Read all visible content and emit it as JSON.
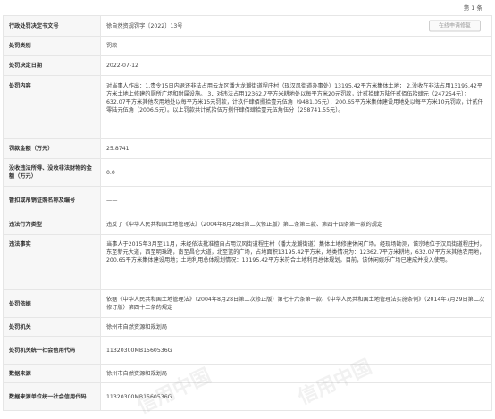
{
  "page": {
    "number_label": "第 1 条"
  },
  "online_button": "在线申请修复",
  "watermark": "信用中国",
  "rows": [
    {
      "label": "行政处罚决定书文号",
      "value": "徐自然资规罚字〔2022〕13号"
    },
    {
      "label": "处罚类别",
      "value": "罚款"
    },
    {
      "label": "处罚决定日期",
      "value": "2022-07-12"
    },
    {
      "label": "处罚内容",
      "value": "对当事人作出：1.责令15日内退还非法占用云龙区潘大龙潮街道程庄村（现汉风街道办事处）13195.42平方米集体土地； 2.没收在非法占用13195.42平方米土地上修建的厕所广场和附属设施。 3．对违法占用12362.7平方米耕地处以每平方米20元罚款，计贰拾肆万陆仟贰佰伍拾肆元（247254元）；632.07平方米其他农用地处以每平方米15元罚款，计玖仟肆佰捌拾壹元伍角（9481.05元）；200.65平方米集体建设用地处以每平方米10元罚款，计贰仟零陆元伍角（2006.5元）。以上罚款共计贰拾伍万捌仟肆佰肆拾壹元伍角伍分（258741.55元）。"
    },
    {
      "label": "罚款金额（万元）",
      "value": "25.8741"
    },
    {
      "label": "没收违法所得、没收非法财物的金额（万元）",
      "value": "0.0"
    },
    {
      "label": "暂扣或吊销证照名称及编号",
      "value": "——"
    },
    {
      "label": "违法行为类型",
      "value": "违反了《中华人民共和国土地管理法》（2004年8月28日第二次修正版）第二条第三款、第四十四条第一款的规定"
    },
    {
      "label": "违法事实",
      "value": "当事人于2015年3月至11月，未经依法批准擅自占用汉风街道程庄村（潘大龙潮街道）集体土地修建休闲广场。经现场勘测，该宗地位于汉风街道程庄村，东至新元大道，西至明珠路，南至昌仑大道，北至篮的广场，占地面积13195.42平方米，地类情况为：12362.7平方米耕地，632.07平方米其他农用地，200.65平方米集体建设用地；土地利用总体规划情况：13195.42平方米符合土地利用总体规划。目前，该休闲娱乐广场已建成并投入使用。"
    },
    {
      "label": "处罚依据",
      "value": "依据《中华人民共和国土地管理法》（2004年8月28日第二次修正版）第七十六条第一款、《中华人民共和国土地管理法实施条例》（2014年7月29日第二次修订版）第四十二条的规定"
    },
    {
      "label": "处罚机关",
      "value": "徐州市自然资源和规划局"
    },
    {
      "label": "处罚机关统一社会信用代码",
      "value": "11320300MB1560536G"
    },
    {
      "label": "数据来源",
      "value": "徐州市自然资源和规划局"
    },
    {
      "label": "数据来源单位统一社会信用代码",
      "value": "11320300MB1560536G"
    }
  ]
}
